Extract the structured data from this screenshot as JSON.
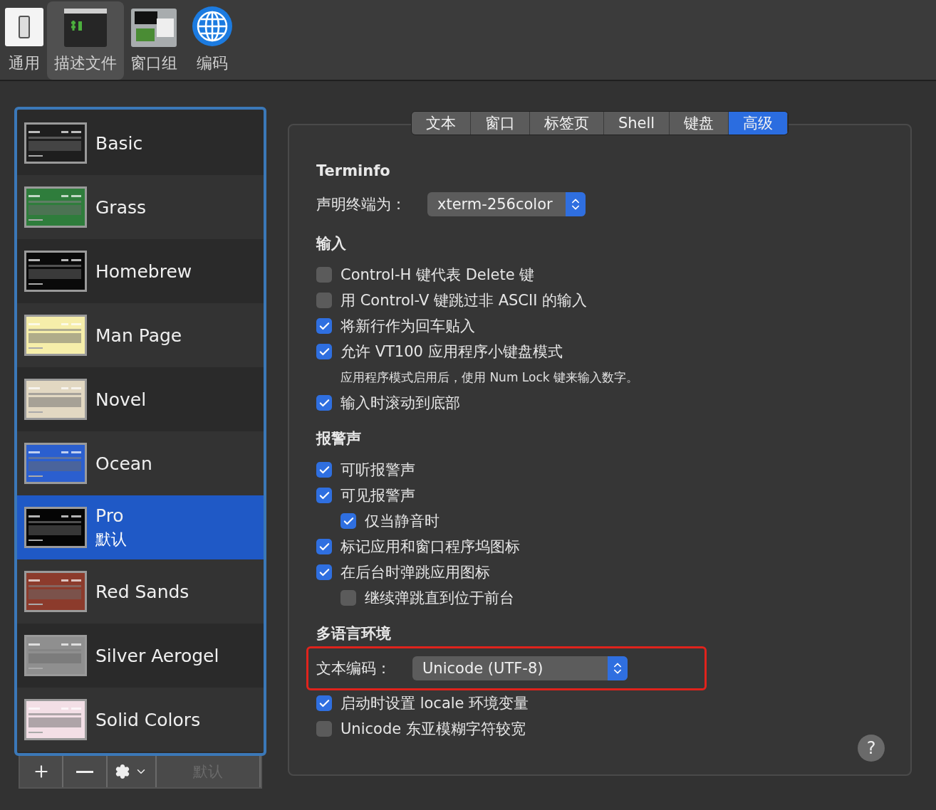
{
  "toolbar": [
    {
      "label": "通用",
      "kind": "switch",
      "selected": false
    },
    {
      "label": "描述文件",
      "kind": "terminal",
      "selected": true
    },
    {
      "label": "窗口组",
      "kind": "windows",
      "selected": false
    },
    {
      "label": "编码",
      "kind": "globe",
      "selected": false
    }
  ],
  "profiles": [
    {
      "name": "Basic",
      "color": "#1e1e1e",
      "selected": false
    },
    {
      "name": "Grass",
      "color": "#2f7d3c",
      "selected": false
    },
    {
      "name": "Homebrew",
      "color": "#0a0a0a",
      "selected": false
    },
    {
      "name": "Man Page",
      "color": "#f6eeaa",
      "selected": false
    },
    {
      "name": "Novel",
      "color": "#e2d8c2",
      "selected": false
    },
    {
      "name": "Ocean",
      "color": "#2b5fcf",
      "selected": false
    },
    {
      "name": "Pro",
      "subtitle": "默认",
      "color": "#050505",
      "selected": true
    },
    {
      "name": "Red Sands",
      "color": "#8c3b2c",
      "selected": false
    },
    {
      "name": "Silver Aerogel",
      "color": "#8f8f8f",
      "selected": false
    },
    {
      "name": "Solid Colors",
      "color": "#f3dfe6",
      "selected": false
    }
  ],
  "profile_actions": [
    {
      "kind": "plus"
    },
    {
      "kind": "minus"
    },
    {
      "kind": "gear"
    },
    {
      "kind": "text",
      "label": "默认",
      "disabled": true
    }
  ],
  "tabs": [
    {
      "label": "文本",
      "selected": false
    },
    {
      "label": "窗口",
      "selected": false
    },
    {
      "label": "标签页",
      "selected": false
    },
    {
      "label": "Shell",
      "selected": false
    },
    {
      "label": "键盘",
      "selected": false
    },
    {
      "label": "高级",
      "selected": true
    }
  ],
  "sections": [
    {
      "title": "Terminfo",
      "items": [
        {
          "kind": "select",
          "label": "声明终端为：",
          "value": "xterm-256color"
        }
      ]
    },
    {
      "title": "输入",
      "items": [
        {
          "kind": "checkbox",
          "label": "Control-H 键代表 Delete 键",
          "checked": false
        },
        {
          "kind": "checkbox",
          "label": "用 Control-V 键跳过非 ASCII 的输入",
          "checked": false
        },
        {
          "kind": "checkbox",
          "label": "将新行作为回车贴入",
          "checked": true
        },
        {
          "kind": "checkbox",
          "label": "允许 VT100 应用程序小键盘模式",
          "checked": true
        },
        {
          "kind": "note",
          "label": "应用程序模式启用后，使用 Num Lock 键来输入数字。"
        },
        {
          "kind": "checkbox",
          "label": "输入时滚动到底部",
          "checked": true
        }
      ]
    },
    {
      "title": "报警声",
      "items": [
        {
          "kind": "checkbox",
          "label": "可听报警声",
          "checked": true
        },
        {
          "kind": "checkbox",
          "label": "可见报警声",
          "checked": true,
          "children": [
            {
              "kind": "checkbox",
              "label": "仅当静音时",
              "checked": true
            }
          ]
        },
        {
          "kind": "checkbox",
          "label": "标记应用和窗口程序坞图标",
          "checked": true
        },
        {
          "kind": "checkbox",
          "label": "在后台时弹跳应用图标",
          "checked": true,
          "children": [
            {
              "kind": "checkbox",
              "label": "继续弹跳直到位于前台",
              "checked": false
            }
          ]
        }
      ]
    },
    {
      "title": "多语言环境",
      "items": [
        {
          "kind": "select",
          "label": "文本编码：",
          "value": "Unicode (UTF-8)",
          "highlighted": true
        },
        {
          "kind": "checkbox",
          "label": "启动时设置 locale 环境变量",
          "checked": true
        },
        {
          "kind": "checkbox",
          "label": "Unicode 东亚模糊字符较宽",
          "checked": false
        }
      ]
    }
  ],
  "help_button": "?"
}
